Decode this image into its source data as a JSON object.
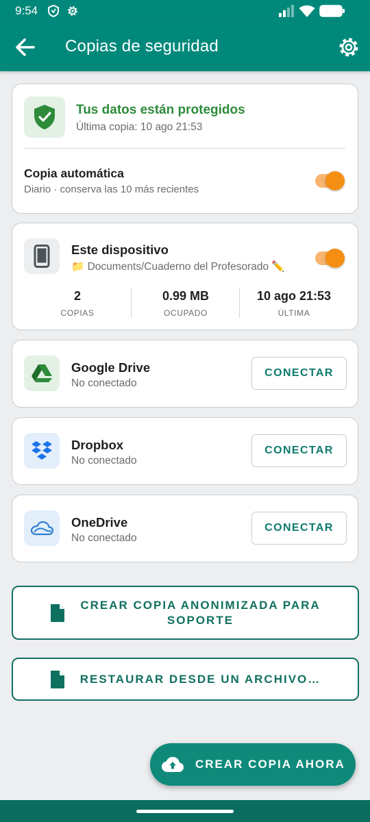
{
  "status_bar": {
    "time": "9:54"
  },
  "app_bar": {
    "title": "Copias de seguridad"
  },
  "protection": {
    "title": "Tus datos están protegidos",
    "last_backup": "Última copia: 10 ago 21:53",
    "auto_backup_label": "Copia automática",
    "auto_backup_detail": "Diario · conserva las 10 más recientes",
    "auto_backup_enabled": true
  },
  "device": {
    "title": "Este dispositivo",
    "path": "📁 Documents/Cuaderno del Profesorado ✏️",
    "enabled": true,
    "stats": [
      {
        "value": "2",
        "label": "COPIAS"
      },
      {
        "value": "0.99 MB",
        "label": "OCUPADO"
      },
      {
        "value": "10 ago 21:53",
        "label": "ÚLTIMA"
      }
    ]
  },
  "providers": [
    {
      "name": "Google Drive",
      "status": "No conectado",
      "button": "CONECTAR",
      "icon": "google-drive-icon"
    },
    {
      "name": "Dropbox",
      "status": "No conectado",
      "button": "CONECTAR",
      "icon": "dropbox-icon"
    },
    {
      "name": "OneDrive",
      "status": "No conectado",
      "button": "CONECTAR",
      "icon": "onedrive-icon"
    }
  ],
  "actions": {
    "anonymized_line1": "CREAR COPIA ANONIMIZADA PARA",
    "anonymized_line2": "SOPORTE",
    "restore": "RESTAURAR DESDE UN ARCHIVO…"
  },
  "fab": {
    "label": "CREAR COPIA AHORA"
  },
  "colors": {
    "primary": "#00897b",
    "accent": "#f58f14",
    "success": "#2e8b3a"
  }
}
